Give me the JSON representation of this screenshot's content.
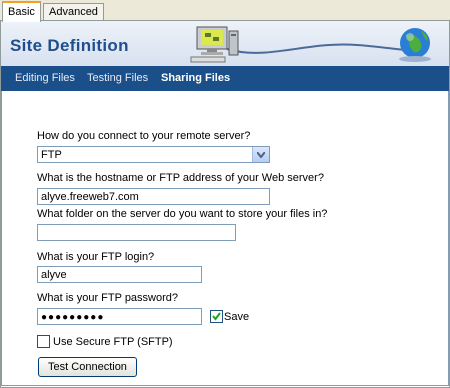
{
  "tabs": [
    {
      "label": "Basic",
      "active": true
    },
    {
      "label": "Advanced",
      "active": false
    }
  ],
  "banner": {
    "title": "Site Definition"
  },
  "nav": [
    {
      "label": "Editing Files",
      "active": false
    },
    {
      "label": "Testing Files",
      "active": false
    },
    {
      "label": "Sharing Files",
      "active": true
    }
  ],
  "form": {
    "connect_question": "How do you connect to your remote server?",
    "connect_value": "FTP",
    "host_question": "What is the hostname or FTP address of your Web server?",
    "host_value": "alyve.freeweb7.com",
    "folder_question": "What folder on the server do you want to store your files in?",
    "folder_value": "",
    "login_question": "What is your FTP login?",
    "login_value": "alyve",
    "password_question": "What is your FTP password?",
    "password_value": "●●●●●●●●●",
    "save_label": "Save",
    "save_checked": true,
    "sftp_label": "Use Secure FTP (SFTP)",
    "sftp_checked": false,
    "test_button": "Test Connection"
  },
  "icons": {
    "banner_illustration": "computer-network-globe-icon",
    "dropdown": "chevron-down-icon",
    "check": "checkmark-icon"
  },
  "colors": {
    "nav_bar": "#1b4f89",
    "title": "#1f4f8f",
    "field_border": "#7f9db9"
  }
}
